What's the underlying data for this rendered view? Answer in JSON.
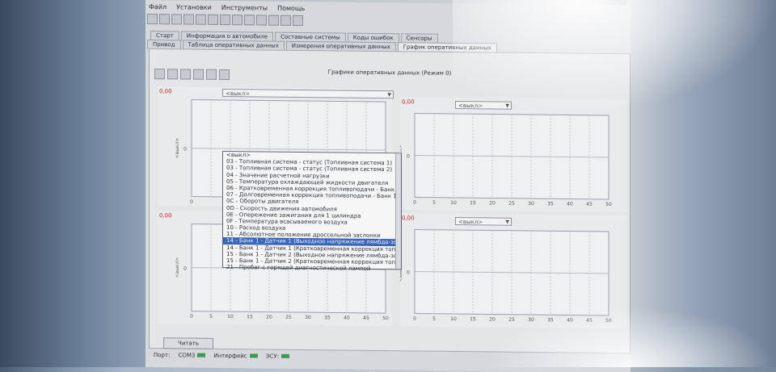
{
  "menu": [
    "Файл",
    "Установки",
    "Инструменты",
    "Помощь"
  ],
  "tabs_row1": [
    "Старт",
    "Информация о автомобиле",
    "Составные системы",
    "Коды ошибок",
    "Сенсоры"
  ],
  "tabs_row2": [
    "Привод",
    "Таблица оперативных данных",
    "Измерения оперативных данных",
    "График оперативных данных"
  ],
  "panel_title": "Графики оперативных данных (Режим 0)",
  "charts": [
    {
      "value": "0,00",
      "select": "<выкл>",
      "ylabel": "<выкл>",
      "zero": "0",
      "ticks": [
        "0",
        "5"
      ]
    },
    {
      "value": "0,00",
      "select": "<выкл>",
      "ylabel": "<выкл>",
      "zero": "0",
      "ticks": [
        "0",
        "5",
        "10",
        "15",
        "20",
        "25",
        "30",
        "35",
        "40",
        "45",
        "50"
      ]
    },
    {
      "value": "0,00",
      "select": "<выкл>",
      "ylabel": "<выкл>",
      "zero": "0",
      "ticks": [
        "0",
        "5",
        "10",
        "15",
        "20",
        "25",
        "30",
        "35",
        "40",
        "45",
        "50"
      ]
    },
    {
      "value": "0,00",
      "select": "<выкл>",
      "ylabel": "<выкл>",
      "zero": "0",
      "ticks": [
        "0",
        "5",
        "10",
        "15",
        "20",
        "25",
        "30",
        "35",
        "40",
        "45",
        "50"
      ]
    }
  ],
  "dropdown_items": [
    "<выкл>",
    "03 - Топливная система - статус (Топливная система 1)",
    "03 - Топливная система - статус (Топливная система 2)",
    "04 - Значение расчетной нагрузки",
    "05 - Температура охлаждающей жидкости двигателя",
    "06 - Кратковременная коррекция топливоподачи - Банк 1",
    "07 - Долговременная коррекция топливоподачи - Банк 1",
    "0C - Обороты двигателя",
    "0D - Скорость движения автомобиля",
    "0E - Опережение зажигания для 1 цилиндра",
    "0F - Температура всасываемого воздуха",
    "10 - Расход воздуха",
    "11 - Абсолютное положение дроссельной заслонки",
    "14 - Банк 1 - Датчик 1 (Выходное напряжение лямбда-зонда)",
    "14 - Банк 1 - Датчик 1 (Кратковременная коррекция топливоподачи)",
    "15 - Банк 1 - Датчик 2 (Выходное напряжение лямбда-зонда)",
    "15 - Банк 1 - Датчик 2 (Кратковременная коррекция топливоподачи)",
    "21 - Пробег с горящей диагностической лампой"
  ],
  "highlighted_index": 13,
  "read_button": "Читать",
  "status": [
    {
      "label": "Порт:",
      "led": false
    },
    {
      "label": "COM3",
      "led": true
    },
    {
      "label": "Интерфейс",
      "led": true
    },
    {
      "label": "ЭСУ:",
      "led": true
    }
  ]
}
